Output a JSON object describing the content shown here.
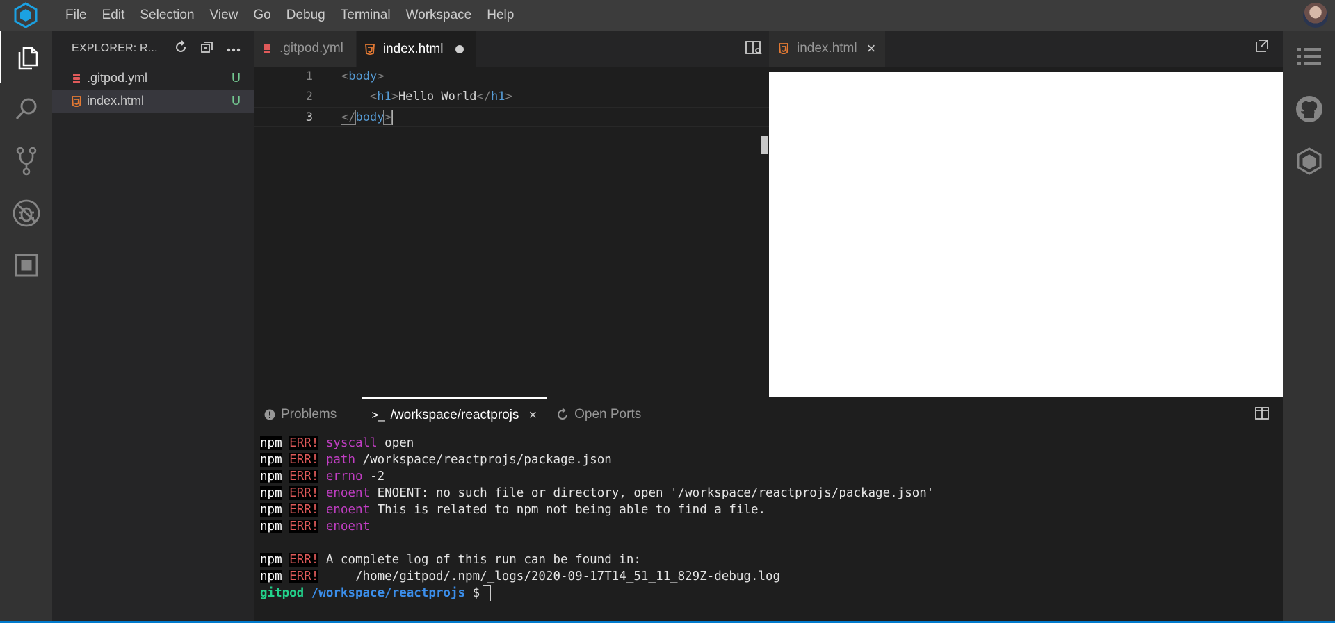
{
  "menu": [
    "File",
    "Edit",
    "Selection",
    "View",
    "Go",
    "Debug",
    "Terminal",
    "Workspace",
    "Help"
  ],
  "sidebar": {
    "title": "EXPLORER: R...",
    "files": [
      {
        "name": ".gitpod.yml",
        "status": "U",
        "icon": "yaml-file-icon"
      },
      {
        "name": "index.html",
        "status": "U",
        "icon": "html-file-icon"
      }
    ]
  },
  "editor": {
    "tabs": [
      {
        "label": ".gitpod.yml",
        "icon": "yaml-file-icon"
      },
      {
        "label": "index.html",
        "icon": "html-file-icon",
        "modified": true
      }
    ],
    "lines": [
      {
        "number": "1",
        "open": "<",
        "tag": "body",
        "close": ">"
      },
      {
        "number": "2",
        "indent": "    ",
        "open": "<",
        "tag": "h1",
        "close": ">",
        "text": "Hello World",
        "open2": "</",
        "tag2": "h1",
        "close2": ">"
      },
      {
        "number": "3",
        "open": "</",
        "tag": "body",
        "close": ">"
      }
    ]
  },
  "preview": {
    "tab_label": "index.html",
    "close": "×"
  },
  "panel": {
    "tabs": {
      "problems": "Problems",
      "terminal": "/workspace/reactprojs",
      "terminal_prefix": ">_",
      "ports": "Open Ports",
      "close": "×"
    },
    "terminal": {
      "npm": "npm",
      "err": "ERR!",
      "lines": [
        {
          "key": "syscall",
          "text": " open"
        },
        {
          "key": "path",
          "text": " /workspace/reactprojs/package.json"
        },
        {
          "key": "errno",
          "text": " -2"
        },
        {
          "key": "enoent",
          "text": " ENOENT: no such file or directory, open '/workspace/reactprojs/package.json'"
        },
        {
          "key": "enoent",
          "text": " This is related to npm not being able to find a file."
        },
        {
          "key": "enoent",
          "text": ""
        }
      ],
      "log_lines": [
        " A complete log of this run can be found in:",
        "     /home/gitpod/.npm/_logs/2020-09-17T14_51_11_829Z-debug.log"
      ],
      "prompt_user": "gitpod",
      "prompt_path": "/workspace/reactprojs",
      "prompt_symbol": "$"
    }
  },
  "colors": {
    "accent": "#007acc",
    "git_untracked": "#73c991",
    "html_icon": "#e37933",
    "yaml_icon": "#e05a5a"
  }
}
